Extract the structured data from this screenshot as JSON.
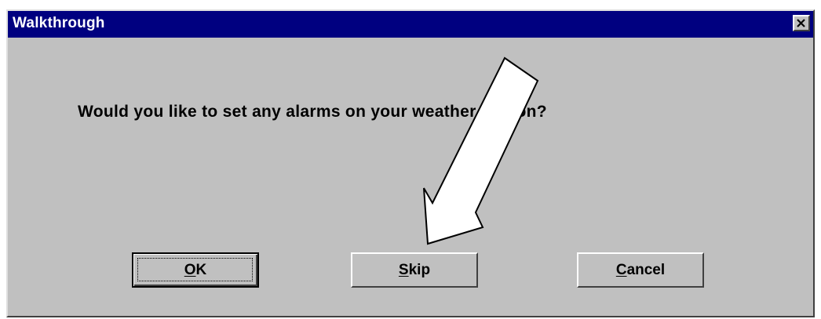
{
  "window": {
    "title": "Walkthrough",
    "close_icon": "close-x-icon"
  },
  "dialog": {
    "message": "Would you like to set any alarms on your weather station?"
  },
  "buttons": {
    "ok": {
      "mnemonic": "O",
      "rest": "K"
    },
    "skip": {
      "mnemonic": "S",
      "rest": "kip"
    },
    "cancel": {
      "mnemonic": "C",
      "rest": "ancel"
    }
  },
  "annotation": {
    "icon": "callout-arrow-icon",
    "fill_color": "#ffffff",
    "stroke_color": "#000000"
  },
  "colors": {
    "titlebar": "#000080",
    "dialog_bg": "#c0c0c0"
  }
}
